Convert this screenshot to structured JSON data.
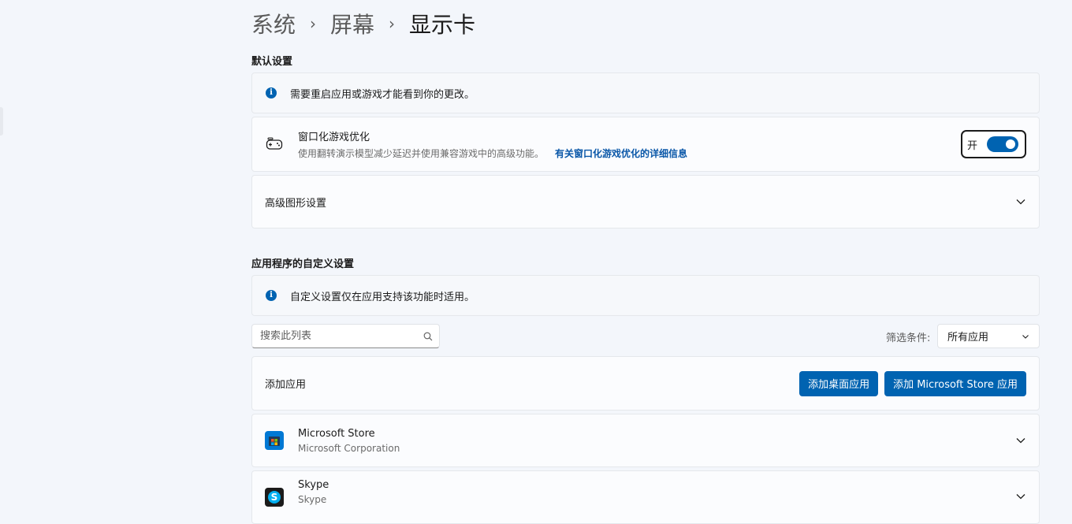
{
  "breadcrumb": [
    "系统",
    "屏幕",
    "显示卡"
  ],
  "breadcrumb_sep": "›",
  "default_settings": {
    "title": "默认设置",
    "info_text": "需要重启应用或游戏才能看到你的更改。",
    "windowed_game": {
      "title": "窗口化游戏优化",
      "description": "使用翻转演示模型减少延迟并使用兼容游戏中的高级功能。",
      "link": "有关窗口化游戏优化的详细信息",
      "toggle_label": "开",
      "toggle_on": true
    },
    "advanced_graphics": "高级图形设置"
  },
  "custom_settings": {
    "title": "应用程序的自定义设置",
    "info_text": "自定义设置仅在应用支持该功能时适用。",
    "search_placeholder": "搜索此列表",
    "filter_label": "筛选条件:",
    "filter_value": "所有应用",
    "add_app": {
      "label": "添加应用",
      "desktop_button": "添加桌面应用",
      "store_button": "添加 Microsoft Store 应用"
    },
    "apps": [
      {
        "name": "Microsoft Store",
        "publisher": "Microsoft Corporation",
        "icon": "microsoft-store-icon"
      },
      {
        "name": "Skype",
        "publisher": "Skype",
        "icon": "skype-icon"
      }
    ]
  },
  "colors": {
    "accent": "#0063b1",
    "link": "#0a57a8",
    "background": "#f3f6fb"
  }
}
